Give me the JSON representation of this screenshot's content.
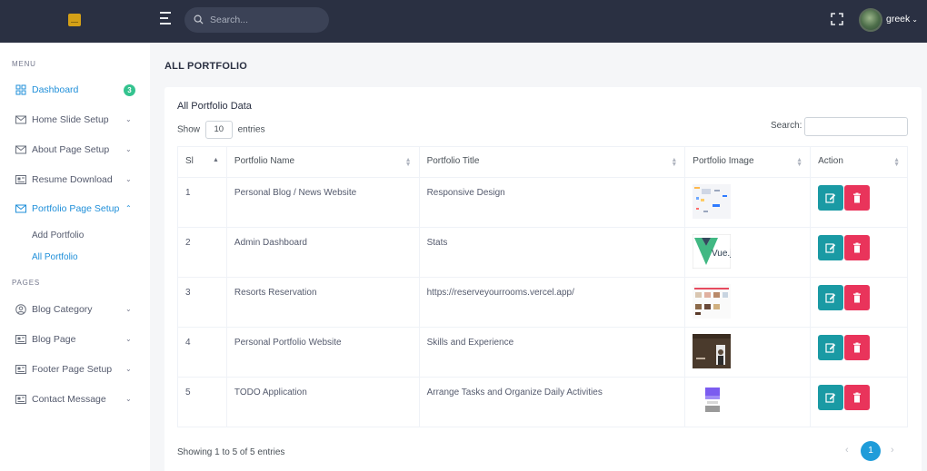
{
  "header": {
    "search_placeholder": "Search...",
    "username": "greek",
    "caret": "⌄"
  },
  "sidebar": {
    "menu_title": "MENU",
    "pages_title": "PAGES",
    "items": [
      {
        "label": "Dashboard",
        "icon": "grid-icon",
        "badge": "3",
        "active": true
      },
      {
        "label": "Home Slide Setup",
        "icon": "mail-icon",
        "chevron": "⌄"
      },
      {
        "label": "About Page Setup",
        "icon": "mail-icon",
        "chevron": "⌄"
      },
      {
        "label": "Resume Download",
        "icon": "newspaper-icon",
        "chevron": "⌄"
      },
      {
        "label": "Portfolio Page Setup",
        "icon": "mail-icon",
        "chevron": "⌃",
        "active": true
      }
    ],
    "sub_items": [
      {
        "label": "Add Portfolio"
      },
      {
        "label": "All Portfolio",
        "current": true
      }
    ],
    "page_items": [
      {
        "label": "Blog Category",
        "icon": "user-circle-icon",
        "chevron": "⌄"
      },
      {
        "label": "Blog Page",
        "icon": "newspaper-icon",
        "chevron": "⌄"
      },
      {
        "label": "Footer Page Setup",
        "icon": "newspaper-icon",
        "chevron": "⌄"
      },
      {
        "label": "Contact Message",
        "icon": "newspaper-icon",
        "chevron": "⌄"
      }
    ]
  },
  "main": {
    "page_title": "ALL PORTFOLIO",
    "card_title": "All Portfolio Data",
    "show_label": "Show",
    "entries_value": "10",
    "entries_label": "entries",
    "search_label": "Search:",
    "columns": [
      "Sl",
      "Portfolio Name",
      "Portfolio Title",
      "Portfolio Image",
      "Action"
    ],
    "rows": [
      {
        "sl": "1",
        "name": "Personal Blog / News Website",
        "title": "Responsive Design",
        "image": "blog-website-thumbnail"
      },
      {
        "sl": "2",
        "name": "Admin Dashboard",
        "title": "Stats",
        "image": "vuejs-logo-thumbnail",
        "image_text": "Vue.js"
      },
      {
        "sl": "3",
        "name": "Resorts Reservation",
        "title": "https://reserveyourrooms.vercel.app/",
        "image": "resort-website-thumbnail"
      },
      {
        "sl": "4",
        "name": "Personal Portfolio Website",
        "title": "Skills and Experience",
        "image": "portfolio-website-thumbnail"
      },
      {
        "sl": "5",
        "name": "TODO Application",
        "title": "Arrange Tasks and Organize Daily Activities",
        "image": "todo-app-thumbnail"
      }
    ],
    "info": "Showing 1 to 5 of 5 entries",
    "pagination": {
      "prev": "‹",
      "current": "1",
      "next": "›"
    },
    "colors": {
      "edit": "#1a9aa4",
      "delete": "#e9345b",
      "accent": "#1f8fd9",
      "topbar": "#2a3042"
    }
  }
}
